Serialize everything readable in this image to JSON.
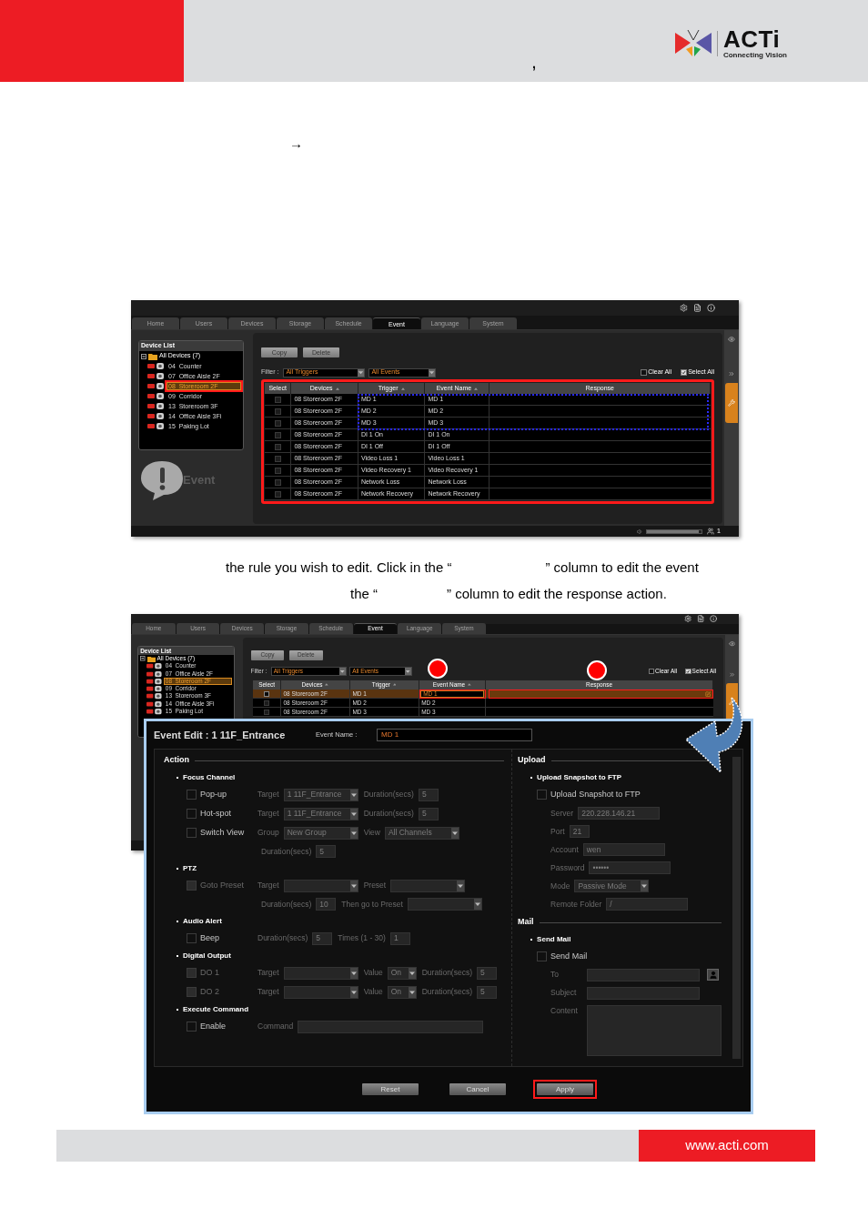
{
  "header": {
    "mark": ",",
    "logo": {
      "name": "ACTi",
      "tagline": "Connecting Vision"
    }
  },
  "arrow": "→",
  "screenshots": [
    {
      "tabs": [
        {
          "label": "Home",
          "selected": false
        },
        {
          "label": "Users",
          "selected": false
        },
        {
          "label": "Devices",
          "selected": false
        },
        {
          "label": "Storage",
          "selected": false
        },
        {
          "label": "Schedule",
          "selected": false
        },
        {
          "label": "Event",
          "selected": true
        },
        {
          "label": "Language",
          "selected": false
        },
        {
          "label": "System",
          "selected": false
        }
      ],
      "device_list": {
        "title": "Device List",
        "root": "All Devices (7)",
        "expanded": true,
        "devices": [
          {
            "label": "04  Counter",
            "selected": false,
            "outlined": false
          },
          {
            "label": "07  Office Aisle 2F",
            "selected": false,
            "outlined": false
          },
          {
            "label": "08  Storeroom 2F",
            "selected": true,
            "outlined": true
          },
          {
            "label": "09  Corridor",
            "selected": false,
            "outlined": false
          },
          {
            "label": "13  Storeroom 3F",
            "selected": false,
            "outlined": false
          },
          {
            "label": "14  Office Aisle 3Fi",
            "selected": false,
            "outlined": false
          },
          {
            "label": "15  Paking Lot",
            "selected": false,
            "outlined": false
          }
        ]
      },
      "buttons": [
        "Copy",
        "Delete"
      ],
      "filter": {
        "label": "Filter :",
        "triggers": "All Triggers",
        "events": "All Events"
      },
      "clear_all": {
        "label": "Clear All",
        "checked": false
      },
      "select_all": {
        "label": "Select All",
        "checked": true
      },
      "columns": [
        "Select",
        "Devices",
        "Trigger",
        "Event Name",
        "Response"
      ],
      "table_outlined": true,
      "dotted_box": true,
      "rows": [
        {
          "device": "08 Storeroom 2F",
          "trigger": "MD 1",
          "event_name": "MD 1",
          "checked": false,
          "selected": false,
          "editing": false
        },
        {
          "device": "08 Storeroom 2F",
          "trigger": "MD 2",
          "event_name": "MD 2",
          "checked": false,
          "selected": false,
          "editing": false
        },
        {
          "device": "08 Storeroom 2F",
          "trigger": "MD 3",
          "event_name": "MD 3",
          "checked": false,
          "selected": false,
          "editing": false
        },
        {
          "device": "08 Storeroom 2F",
          "trigger": "DI 1 On",
          "event_name": "DI 1 On",
          "checked": false,
          "selected": false,
          "editing": false
        },
        {
          "device": "08 Storeroom 2F",
          "trigger": "DI 1 Off",
          "event_name": "DI 1 Off",
          "checked": false,
          "selected": false,
          "editing": false
        },
        {
          "device": "08 Storeroom 2F",
          "trigger": "Video Loss 1",
          "event_name": "Video Loss 1",
          "checked": false,
          "selected": false,
          "editing": false
        },
        {
          "device": "08 Storeroom 2F",
          "trigger": "Video Recovery 1",
          "event_name": "Video Recovery 1",
          "checked": false,
          "selected": false,
          "editing": false
        },
        {
          "device": "08 Storeroom 2F",
          "trigger": "Network Loss",
          "event_name": "Network Loss",
          "checked": false,
          "selected": false,
          "editing": false
        },
        {
          "device": "08 Storeroom 2F",
          "trigger": "Network Recovery",
          "event_name": "Network Recovery",
          "checked": false,
          "selected": false,
          "editing": false
        }
      ],
      "badge": "Event",
      "status_count": "1",
      "volume": {
        "level": 0.95
      }
    },
    {
      "tabs": [
        {
          "label": "Home",
          "selected": false
        },
        {
          "label": "Users",
          "selected": false
        },
        {
          "label": "Devices",
          "selected": false
        },
        {
          "label": "Storage",
          "selected": false
        },
        {
          "label": "Schedule",
          "selected": false
        },
        {
          "label": "Event",
          "selected": true
        },
        {
          "label": "Language",
          "selected": false
        },
        {
          "label": "System",
          "selected": false
        }
      ],
      "device_list": {
        "title": "Device List",
        "root": "All Devices (7)",
        "expanded": true,
        "devices": [
          {
            "label": "04  Counter",
            "selected": false,
            "outlined": false
          },
          {
            "label": "07  Office Aisle 2F",
            "selected": false,
            "outlined": false
          },
          {
            "label": "08  Storeroom 2F",
            "selected": true,
            "outlined": false
          },
          {
            "label": "09  Corridor",
            "selected": false,
            "outlined": false
          },
          {
            "label": "13  Storeroom 3F",
            "selected": false,
            "outlined": false
          },
          {
            "label": "14  Office Aisle 3Fi",
            "selected": false,
            "outlined": false
          },
          {
            "label": "15  Paking Lot",
            "selected": false,
            "outlined": false
          }
        ]
      },
      "buttons": [
        "Copy",
        "Delete"
      ],
      "filter": {
        "label": "Filter :",
        "triggers": "All Triggers",
        "events": "All Events"
      },
      "clear_all": {
        "label": "Clear All",
        "checked": false
      },
      "select_all": {
        "label": "Select All",
        "checked": true
      },
      "columns": [
        "Select",
        "Devices",
        "Trigger",
        "Event Name",
        "Response"
      ],
      "table_outlined": false,
      "dotted_box": false,
      "rows": [
        {
          "device": "08 Storeroom 2F",
          "trigger": "MD 1",
          "event_name": "MD 1",
          "checked": true,
          "selected": true,
          "editing": true
        },
        {
          "device": "08 Storeroom 2F",
          "trigger": "MD 2",
          "event_name": "MD 2",
          "checked": false,
          "selected": false,
          "editing": false
        },
        {
          "device": "08 Storeroom 2F",
          "trigger": "MD 3",
          "event_name": "MD 3",
          "checked": false,
          "selected": false,
          "editing": false
        }
      ]
    }
  ],
  "instructions": [
    {
      "before": "the rule you wish to edit. Click in the “",
      "after": "” column to edit the event"
    },
    {
      "before": "the “",
      "after": "” column to edit the response action."
    }
  ],
  "dialog": {
    "title": "Event Edit : 1 11F_Entrance",
    "name_label": "Event Name :",
    "name_value": "MD 1",
    "left": [
      {
        "title": "Action",
        "groups": [
          {
            "title": "Focus Channel",
            "lines": [
              {
                "kind": "option",
                "label": "Pop-up",
                "checked": false,
                "disabled": false,
                "parts": [
                  {
                    "kind": "label",
                    "text": "Target"
                  },
                  {
                    "kind": "select",
                    "value": "1 11F_Entrance"
                  },
                  {
                    "kind": "label",
                    "text": "Duration(secs)"
                  },
                  {
                    "kind": "number",
                    "value": "5"
                  }
                ]
              },
              {
                "kind": "option",
                "label": "Hot-spot",
                "checked": false,
                "disabled": false,
                "parts": [
                  {
                    "kind": "label",
                    "text": "Target"
                  },
                  {
                    "kind": "select",
                    "value": "1 11F_Entrance"
                  },
                  {
                    "kind": "label",
                    "text": "Duration(secs)"
                  },
                  {
                    "kind": "number",
                    "value": "5"
                  }
                ]
              },
              {
                "kind": "option",
                "label": "Switch View",
                "checked": false,
                "disabled": false,
                "parts": [
                  {
                    "kind": "label",
                    "text": "Group"
                  },
                  {
                    "kind": "select",
                    "value": "New Group"
                  },
                  {
                    "kind": "label",
                    "text": "View"
                  },
                  {
                    "kind": "select",
                    "value": "All Channels"
                  }
                ]
              },
              {
                "kind": "detail",
                "parts": [
                  {
                    "kind": "label",
                    "text": "Duration(secs)"
                  },
                  {
                    "kind": "number",
                    "value": "5"
                  }
                ]
              }
            ]
          },
          {
            "title": "PTZ",
            "lines": [
              {
                "kind": "option",
                "label": "Goto Preset",
                "checked": false,
                "disabled": true,
                "parts": [
                  {
                    "kind": "label",
                    "text": "Target"
                  },
                  {
                    "kind": "select"
                  },
                  {
                    "kind": "label",
                    "text": "Preset"
                  },
                  {
                    "kind": "select"
                  }
                ]
              },
              {
                "kind": "detail",
                "parts": [
                  {
                    "kind": "label",
                    "text": "Duration(secs)"
                  },
                  {
                    "kind": "number",
                    "value": "10"
                  },
                  {
                    "kind": "label",
                    "text": "Then go to Preset"
                  },
                  {
                    "kind": "select"
                  }
                ]
              }
            ]
          },
          {
            "title": "Audio Alert",
            "lines": [
              {
                "kind": "option",
                "label": "Beep",
                "checked": false,
                "disabled": false,
                "parts": [
                  {
                    "kind": "label",
                    "text": "Duration(secs)"
                  },
                  {
                    "kind": "number",
                    "value": "5"
                  },
                  {
                    "kind": "label",
                    "text": "Times (1 - 30)"
                  },
                  {
                    "kind": "number",
                    "value": "1"
                  }
                ]
              }
            ]
          },
          {
            "title": "Digital Output",
            "lines": [
              {
                "kind": "option",
                "label": "DO 1",
                "checked": false,
                "disabled": true,
                "parts": [
                  {
                    "kind": "label",
                    "text": "Target"
                  },
                  {
                    "kind": "select"
                  },
                  {
                    "kind": "label",
                    "text": "Value"
                  },
                  {
                    "kind": "short_select",
                    "value": "On"
                  },
                  {
                    "kind": "label",
                    "text": "Duration(secs)"
                  },
                  {
                    "kind": "number",
                    "value": "5"
                  }
                ]
              },
              {
                "kind": "option",
                "label": "DO 2",
                "checked": false,
                "disabled": true,
                "parts": [
                  {
                    "kind": "label",
                    "text": "Target"
                  },
                  {
                    "kind": "select"
                  },
                  {
                    "kind": "label",
                    "text": "Value"
                  },
                  {
                    "kind": "short_select",
                    "value": "On"
                  },
                  {
                    "kind": "label",
                    "text": "Duration(secs)"
                  },
                  {
                    "kind": "number",
                    "value": "5"
                  }
                ]
              }
            ]
          },
          {
            "title": "Execute Command",
            "lines": [
              {
                "kind": "option",
                "label": "Enable",
                "checked": false,
                "disabled": false,
                "parts": [
                  {
                    "kind": "label",
                    "text": "Command"
                  },
                  {
                    "kind": "text"
                  }
                ]
              }
            ]
          }
        ]
      }
    ],
    "right": [
      {
        "title": "Upload",
        "groups": [
          {
            "title": "Upload Snapshot to FTP",
            "lines": [
              {
                "kind": "option",
                "label": "Upload Snapshot to FTP",
                "checked": false,
                "disabled": false
              },
              {
                "kind": "detail",
                "parts": [
                  {
                    "kind": "label",
                    "text": "Server"
                  },
                  {
                    "kind": "text",
                    "value": "220.228.146.21"
                  }
                ]
              },
              {
                "kind": "detail",
                "parts": [
                  {
                    "kind": "label",
                    "text": "Port"
                  },
                  {
                    "kind": "number",
                    "value": "21"
                  }
                ]
              },
              {
                "kind": "detail",
                "parts": [
                  {
                    "kind": "label",
                    "text": "Account"
                  },
                  {
                    "kind": "text",
                    "value": "wen"
                  }
                ]
              },
              {
                "kind": "detail",
                "parts": [
                  {
                    "kind": "label",
                    "text": "Password"
                  },
                  {
                    "kind": "text",
                    "value": "••••••"
                  }
                ]
              },
              {
                "kind": "detail",
                "parts": [
                  {
                    "kind": "label",
                    "text": "Mode"
                  },
                  {
                    "kind": "select",
                    "value": "Passive Mode"
                  }
                ]
              },
              {
                "kind": "detail",
                "parts": [
                  {
                    "kind": "label",
                    "text": "Remote Folder"
                  },
                  {
                    "kind": "text",
                    "value": "/"
                  }
                ]
              }
            ]
          }
        ]
      },
      {
        "title": "Mail",
        "groups": [
          {
            "title": "Send Mail",
            "lines": [
              {
                "kind": "option",
                "label": "Send Mail",
                "checked": false,
                "disabled": false
              },
              {
                "kind": "field",
                "label": "To",
                "parts": [
                  {
                    "kind": "text"
                  },
                  {
                    "kind": "contact"
                  }
                ]
              },
              {
                "kind": "field",
                "label": "Subject",
                "parts": [
                  {
                    "kind": "text"
                  }
                ]
              },
              {
                "kind": "field",
                "label": "Content",
                "parts": [
                  {
                    "kind": "area"
                  }
                ]
              }
            ]
          }
        ]
      }
    ],
    "buttons": [
      {
        "label": "Reset",
        "highlighted": false
      },
      {
        "label": "Cancel",
        "highlighted": false
      },
      {
        "label": "Apply",
        "highlighted": true
      }
    ]
  },
  "footer": {
    "url": "www.acti.com"
  }
}
